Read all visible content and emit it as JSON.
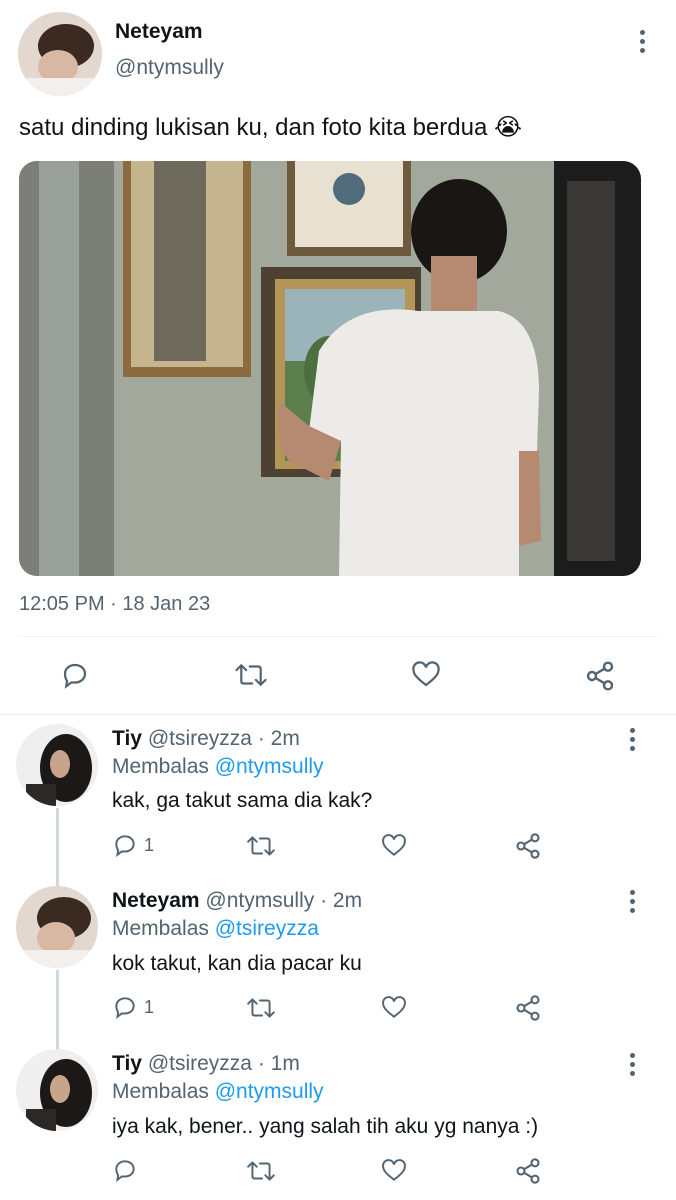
{
  "tweet": {
    "author_name": "Neteyam",
    "author_handle": "@ntymsully",
    "text": "satu dinding lukisan ku, dan foto kita berdua",
    "emoji": "😭",
    "timestamp": "12:05 PM · 18 Jan 23",
    "actions": [
      "reply-icon",
      "retweet-icon",
      "like-icon",
      "share-icon"
    ]
  },
  "replies": [
    {
      "name": "Tiy",
      "handle": "@tsireyzza",
      "time": "· 2m",
      "replying_label": "Membalas",
      "replying_to": "@ntymsully",
      "text": "kak, ga takut sama dia kak?",
      "reply_count": "1"
    },
    {
      "name": "Neteyam",
      "handle": "@ntymsully",
      "time": "· 2m",
      "replying_label": "Membalas",
      "replying_to": "@tsireyzza",
      "text": "kok takut, kan dia pacar ku",
      "reply_count": "1"
    },
    {
      "name": "Tiy",
      "handle": "@tsireyzza",
      "time": "· 1m",
      "replying_label": "Membalas",
      "replying_to": "@ntymsully",
      "text": "iya kak, bener.. yang salah tih aku yg nanya :)",
      "reply_count": ""
    }
  ],
  "colors": {
    "accent": "#1d9bf0",
    "secondary_text": "#536471",
    "icon": "#536471"
  }
}
